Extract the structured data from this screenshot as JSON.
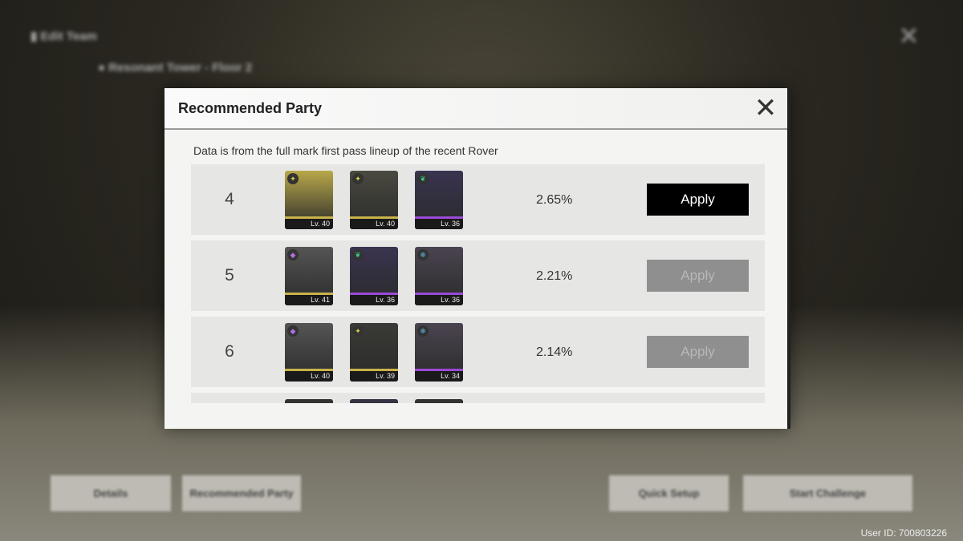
{
  "background": {
    "header": "Edit Team",
    "subheader": "Resonant Tower - Floor 2",
    "buttons": [
      "Details",
      "Recommended Party",
      "Quick Setup",
      "Start Challenge"
    ],
    "user_id": "User ID: 700803226"
  },
  "modal": {
    "title": "Recommended Party",
    "close_icon": "close-x-icon",
    "note": "Data is from the full mark first pass lineup of the recent Rover",
    "apply_label": "Apply",
    "rows": [
      {
        "rank": "4",
        "rate": "2.65%",
        "active": true,
        "chars": [
          {
            "lv": "Lv. 40",
            "element": "spectro",
            "color": "#b8a84a",
            "rarity": "#c9b24a"
          },
          {
            "lv": "Lv. 40",
            "element": "spectro",
            "color": "#4a4a40",
            "rarity": "#c9b24a"
          },
          {
            "lv": "Lv. 36",
            "element": "aero",
            "color": "#3a3450",
            "rarity": "#9a4ad8"
          }
        ]
      },
      {
        "rank": "5",
        "rate": "2.21%",
        "active": false,
        "chars": [
          {
            "lv": "Lv. 41",
            "element": "havoc",
            "color": "#555",
            "rarity": "#c9b24a"
          },
          {
            "lv": "Lv. 36",
            "element": "aero",
            "color": "#3a3450",
            "rarity": "#9a4ad8"
          },
          {
            "lv": "Lv. 36",
            "element": "glacio",
            "color": "#4a4450",
            "rarity": "#9a4ad8"
          }
        ]
      },
      {
        "rank": "6",
        "rate": "2.14%",
        "active": false,
        "chars": [
          {
            "lv": "Lv. 40",
            "element": "havoc",
            "color": "#555",
            "rarity": "#c9b24a"
          },
          {
            "lv": "Lv. 39",
            "element": "spectro",
            "color": "#3a3a36",
            "rarity": "#c9b24a"
          },
          {
            "lv": "Lv. 34",
            "element": "glacio",
            "color": "#4a4450",
            "rarity": "#9a4ad8"
          }
        ]
      }
    ]
  }
}
